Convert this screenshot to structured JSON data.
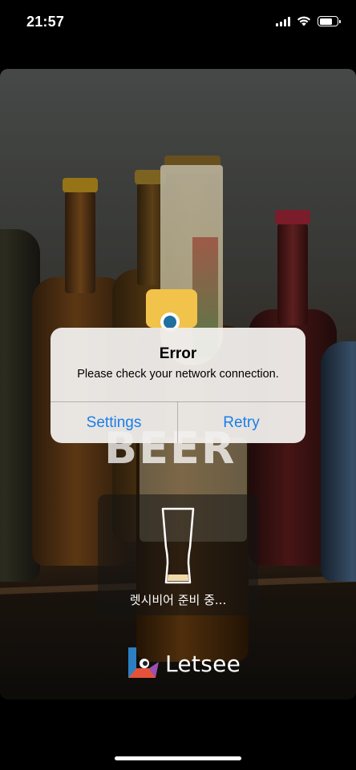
{
  "status_bar": {
    "time": "21:57",
    "signal_icon": "cellular-signal-icon",
    "wifi_icon": "wifi-icon",
    "battery_icon": "battery-icon",
    "battery_level": 0.75
  },
  "scene": {
    "background_text": "BEER",
    "colors": {
      "accent": "#f1c34a"
    }
  },
  "alert": {
    "title": "Error",
    "message": "Please check your network connection.",
    "buttons": [
      {
        "label": "Settings"
      },
      {
        "label": "Retry"
      }
    ],
    "button_color": "#1a7ee8"
  },
  "loading": {
    "icon": "beer-glass-icon",
    "text": "렛시비어 준비 중..."
  },
  "logo": {
    "icon": "letsee-logo-icon",
    "text": "Letsee"
  }
}
